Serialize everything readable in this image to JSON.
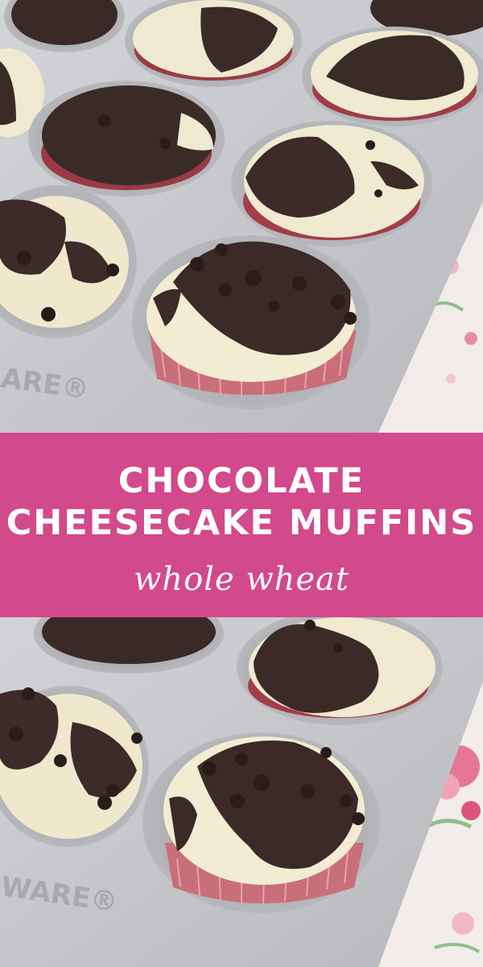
{
  "pin": {
    "title_line1": "CHOCOLATE",
    "title_line2": "CHEESECAKE MUFFINS",
    "subtitle": "whole wheat"
  },
  "pan": {
    "emboss_text_top": "ARE®",
    "emboss_text_bottom": "WARE®"
  },
  "colors": {
    "banner": "#d2498c",
    "banner_text": "#ffffff",
    "pan": "#c4c5c8",
    "chocolate": "#3a2a27",
    "cheesecake": "#f1ecd2",
    "liner": "#c46d78",
    "tablecloth_flowers": "#e77596"
  }
}
